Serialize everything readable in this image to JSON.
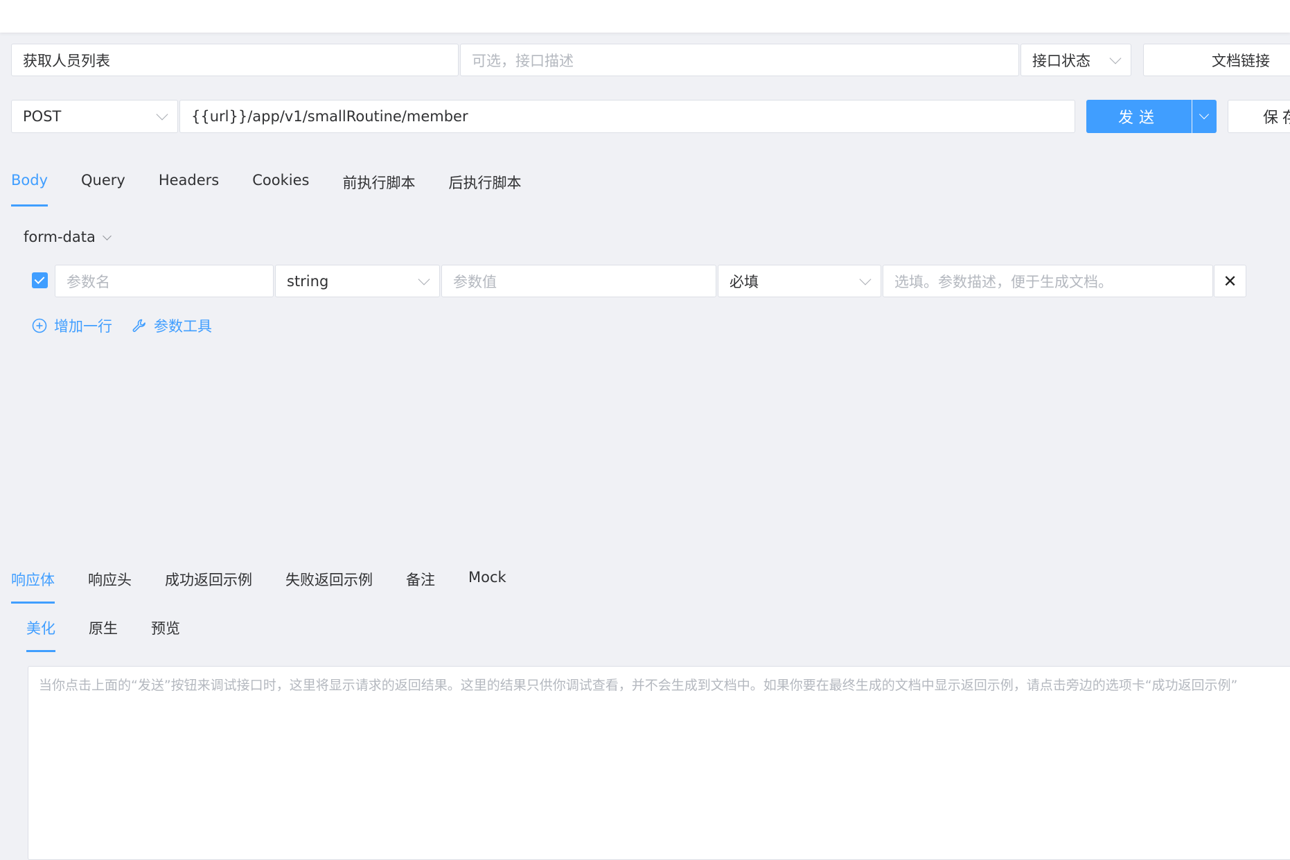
{
  "request": {
    "name": "获取人员列表",
    "description_placeholder": "可选，接口描述",
    "status_label": "接口状态",
    "doc_link_label": "文档链接",
    "method": "POST",
    "url": "{{url}}/app/v1/smallRoutine/member",
    "send_label": "发送",
    "save_label": "保存"
  },
  "request_tabs": [
    {
      "label": "Body",
      "active": true
    },
    {
      "label": "Query"
    },
    {
      "label": "Headers"
    },
    {
      "label": "Cookies"
    },
    {
      "label": "前执行脚本"
    },
    {
      "label": "后执行脚本"
    }
  ],
  "body": {
    "type": "form-data",
    "params": [
      {
        "checked": true,
        "name_placeholder": "参数名",
        "type": "string",
        "value_placeholder": "参数值",
        "required": "必填",
        "desc_placeholder": "选填。参数描述，便于生成文档。"
      }
    ],
    "add_row_label": "增加一行",
    "param_tool_label": "参数工具"
  },
  "response_tabs": [
    {
      "label": "响应体",
      "active": true
    },
    {
      "label": "响应头"
    },
    {
      "label": "成功返回示例"
    },
    {
      "label": "失败返回示例"
    },
    {
      "label": "备注"
    },
    {
      "label": "Mock"
    }
  ],
  "view_tabs": [
    {
      "label": "美化",
      "active": true
    },
    {
      "label": "原生"
    },
    {
      "label": "预览"
    }
  ],
  "result_placeholder": "当你点击上面的“发送”按钮来调试接口时，这里将显示请求的返回结果。这里的结果只供你调试查看，并不会生成到文档中。如果你要在最终生成的文档中显示返回示例，请点击旁边的选项卡“成功返回示例”",
  "colors": {
    "accent": "#409eff",
    "background": "#f0f1f5"
  }
}
